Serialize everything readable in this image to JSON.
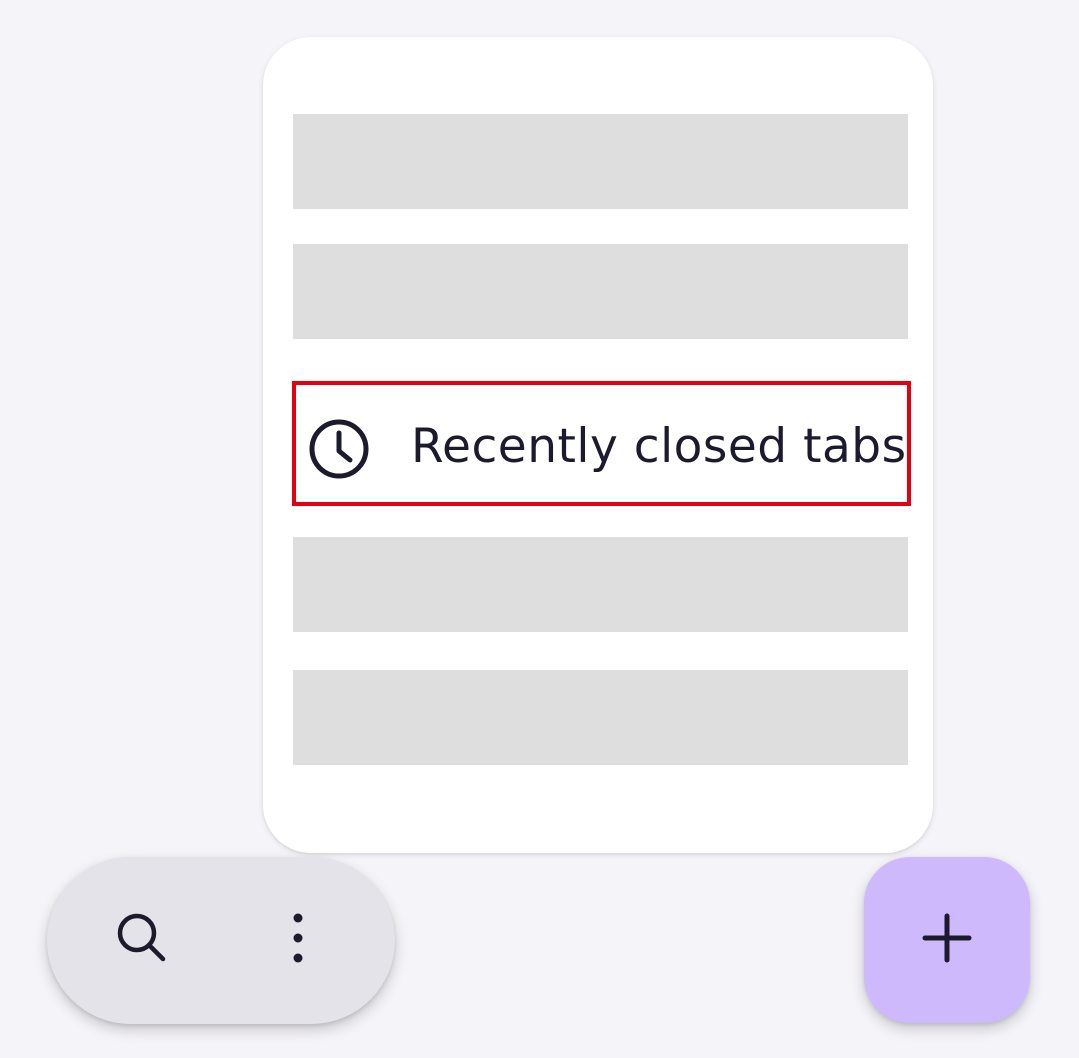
{
  "menu": {
    "items": [
      {
        "icon": "clock-icon",
        "label": "Recently closed tabs"
      }
    ]
  },
  "toolbar": {
    "search_icon": "search-icon",
    "more_icon": "more-vert-icon"
  },
  "fab": {
    "icon": "plus-icon"
  },
  "colors": {
    "background": "#f5f4f9",
    "card": "#ffffff",
    "placeholder": "#dedede",
    "highlight_border": "#e5000f",
    "text": "#1c1b2e",
    "pill": "#e4e3e9",
    "fab": "#cdb9fb"
  }
}
